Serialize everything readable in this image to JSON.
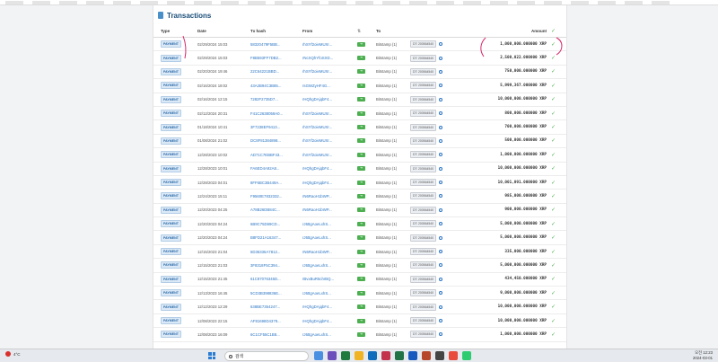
{
  "title": "Transactions",
  "columns": {
    "type": "Type",
    "date": "Date",
    "hash": "Tx hash",
    "from": "From",
    "to": "To",
    "amount": "Amount"
  },
  "rows": [
    {
      "type": "PAYMENT",
      "date": "02/29/2024 15:03",
      "hash": "58320479F5BB...",
      "from": "rhSYf2oieMUXr...",
      "to": "Bitstamp (1)",
      "tag": "DT: 200564540",
      "amount": "1,000,000.000000 XRP"
    },
    {
      "type": "PAYMENT",
      "date": "02/29/2024 15:03",
      "hash": "F8B593FF7DB2...",
      "from": "rNcXQhYfoSXD...",
      "to": "Bitstamp (1)",
      "tag": "DT: 200564540",
      "amount": "2,500,022.000000 XRP"
    },
    {
      "type": "PAYMENT",
      "date": "02/20/2024 19:46",
      "hash": "22C64221BBD...",
      "from": "rhSYf2oieMUXr...",
      "to": "Bitstamp (1)",
      "tag": "DT: 200564540",
      "amount": "750,000.000000 XRP"
    },
    {
      "type": "PAYMENT",
      "date": "02/16/2024 18:02",
      "hash": "43A2B94C3B85...",
      "from": "rsGWZyHF4G...",
      "to": "Bitstamp (1)",
      "tag": "DT: 200564540",
      "amount": "5,999,367.000000 XRP"
    },
    {
      "type": "PAYMENT",
      "date": "02/16/2024 12:15",
      "hash": "7282F2735D7...",
      "from": "rHQhgDAjqbF4...",
      "to": "Bitstamp (1)",
      "tag": "DT: 200564540",
      "amount": "10,000,000.000000 XRP"
    },
    {
      "type": "PAYMENT",
      "date": "02/12/2024 20:31",
      "hash": "F41C2638059A0...",
      "from": "rhSYf2oieMUXr...",
      "to": "Bitstamp (1)",
      "tag": "DT: 200564540",
      "amount": "800,000.000000 XRP"
    },
    {
      "type": "PAYMENT",
      "date": "01/18/2024 10:41",
      "hash": "3F7238EF9413...",
      "from": "rhSYf2oieMUXr...",
      "to": "Bitstamp (1)",
      "tag": "DT: 200564540",
      "amount": "700,000.000000 XRP"
    },
    {
      "type": "PAYMENT",
      "date": "01/08/2024 21:02",
      "hash": "DC8F81384898...",
      "from": "rhSYf2oieMUXr...",
      "to": "Bitstamp (1)",
      "tag": "DT: 200564540",
      "amount": "500,000.000000 XRP"
    },
    {
      "type": "PAYMENT",
      "date": "12/28/2023 10:02",
      "hash": "AD71C7EBBF43...",
      "from": "rhSYf2oieMUXr...",
      "to": "Bitstamp (1)",
      "tag": "DT: 200564540",
      "amount": "1,000,000.000000 XRP"
    },
    {
      "type": "PAYMENT",
      "date": "12/28/2023 10:01",
      "hash": "FA6ED4A92A8...",
      "from": "rHQhgDAjqbF4...",
      "to": "Bitstamp (1)",
      "tag": "DT: 200564540",
      "amount": "10,000,000.000000 XRP"
    },
    {
      "type": "PAYMENT",
      "date": "12/28/2023 04:01",
      "hash": "8FF6BC3B449A...",
      "from": "rHQhgDAjqbF4...",
      "to": "Bitstamp (1)",
      "tag": "DT: 200564540",
      "amount": "10,001,091.000000 XRP"
    },
    {
      "type": "PAYMENT",
      "date": "12/24/2023 15:11",
      "hash": "F9560E7832332...",
      "from": "rN6RaoH1bWP...",
      "to": "Bitstamp (1)",
      "tag": "DT: 200564540",
      "amount": "985,000.000000 XRP"
    },
    {
      "type": "PAYMENT",
      "date": "12/20/2023 04:25",
      "hash": "A78B26DB84C...",
      "from": "rN6RaoH1bWP...",
      "to": "Bitstamp (1)",
      "tag": "DT: 200564540",
      "amount": "900,000.000000 XRP"
    },
    {
      "type": "PAYMENT",
      "date": "12/20/2023 04:24",
      "hash": "6B9C75D69CD...",
      "from": "rJ6ttgAoeLxhS...",
      "to": "Bitstamp (1)",
      "tag": "DT: 200564540",
      "amount": "5,000,000.000000 XRP"
    },
    {
      "type": "PAYMENT",
      "date": "12/20/2023 04:24",
      "hash": "B8FD21A16347...",
      "from": "rJ6ttgAoeLxhS...",
      "to": "Bitstamp (1)",
      "tag": "DT: 200564540",
      "amount": "5,000,000.000000 XRP"
    },
    {
      "type": "PAYMENT",
      "date": "12/15/2023 21:04",
      "hash": "5D36336A7812...",
      "from": "rN6RaoH1bWP...",
      "to": "Bitstamp (1)",
      "tag": "DT: 200564540",
      "amount": "335,000.000000 XRP"
    },
    {
      "type": "PAYMENT",
      "date": "12/15/2023 21:03",
      "hash": "3F8318F5C394...",
      "from": "rJ6ttgAoeLxhS...",
      "to": "Bitstamp (1)",
      "tag": "DT: 200564540",
      "amount": "5,000,000.000000 XRP"
    },
    {
      "type": "PAYMENT",
      "date": "12/15/2023 21:45",
      "hash": "61C87076345D...",
      "from": "rBvxBuR5chrBQ...",
      "to": "Bitstamp (1)",
      "tag": "DT: 200564540",
      "amount": "434,450.000000 XRP"
    },
    {
      "type": "PAYMENT",
      "date": "12/13/2023 16:45",
      "hash": "5CD3B398836E...",
      "from": "rJ6ttgAoeLxhS...",
      "to": "Bitstamp (1)",
      "tag": "DT: 200564540",
      "amount": "9,000,000.000000 XRP"
    },
    {
      "type": "PAYMENT",
      "date": "12/12/2023 12:29",
      "hash": "638BE7354247...",
      "from": "rHQhgDAjqbF4...",
      "to": "Bitstamp (1)",
      "tag": "DT: 200564540",
      "amount": "10,000,000.000000 XRP"
    },
    {
      "type": "PAYMENT",
      "date": "12/08/2023 22:15",
      "hash": "AF81698D4379...",
      "from": "rHQhgDAjqbF4...",
      "to": "Bitstamp (1)",
      "tag": "DT: 200564540",
      "amount": "10,000,000.000000 XRP"
    },
    {
      "type": "PAYMENT",
      "date": "12/08/2023 16:09",
      "hash": "6C1CF55C1B8...",
      "from": "rJ6ttgAoeLxhS...",
      "to": "Bitstamp (1)",
      "tag": "DT: 200564540",
      "amount": "1,000,000.000000 XRP"
    }
  ],
  "taskbar": {
    "weather_temp": "4°C",
    "search_placeholder": "검색",
    "time": "오전 12:23",
    "date": "2024-03-01"
  },
  "colors": {
    "accent": "#2c76c4",
    "arrow_green": "#4caf50",
    "annotation": "#d6286a"
  },
  "icons": {
    "title": "document-icon",
    "sort": "sort-arrows-icon",
    "check": "check-icon",
    "search": "magnifier-icon"
  }
}
